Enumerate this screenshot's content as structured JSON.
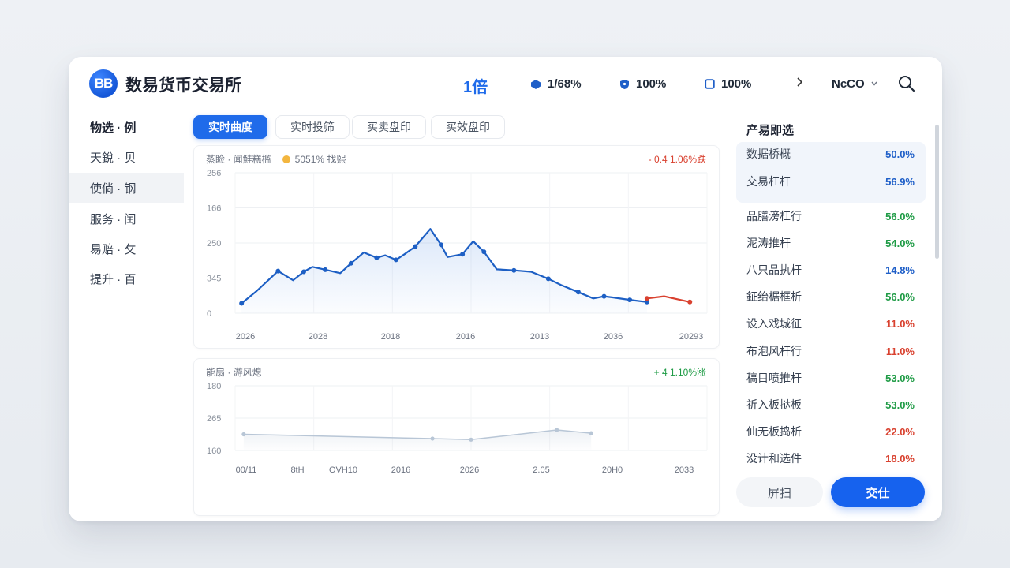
{
  "app": {
    "logo_text": "BB",
    "title": "数易货币交易所"
  },
  "header": {
    "leverage": "1倍",
    "stats": [
      {
        "icon": "hexagon-icon",
        "value": "1/68%"
      },
      {
        "icon": "shield-icon",
        "value": "100%"
      },
      {
        "icon": "square-icon",
        "value": "100%"
      }
    ],
    "account": "NcCO",
    "colors": {
      "accent": "#1f6bea"
    }
  },
  "sidebar": {
    "items": [
      {
        "label": "物选 · 例",
        "heading": true
      },
      {
        "label": "天銳 · 贝"
      },
      {
        "label": "使倘 · 钢",
        "active": true
      },
      {
        "label": "服务 · 闰"
      },
      {
        "label": "易赔 · 攵"
      },
      {
        "label": "提升 · 百"
      }
    ]
  },
  "tabs": [
    {
      "label": "实时曲度",
      "active": true
    },
    {
      "label": "实时投筛"
    },
    {
      "label": "买卖盘印"
    },
    {
      "label": "买效盘印"
    }
  ],
  "charts": {
    "main": {
      "title": "蒸睑 · 闻鮭糕槛",
      "legend": "5051%  找熙",
      "change": "- 0.4  1.06%跌"
    },
    "secondary": {
      "title": "能扇 · 游风熄",
      "change": "+ 4  1.10%涨"
    }
  },
  "chart_data": [
    {
      "type": "line",
      "title": "蒸睑 · 闻鮭糕槛",
      "y_tick_labels": [
        "0",
        "345",
        "250",
        "166",
        "256"
      ],
      "x_tick_labels": [
        "2026",
        "2028",
        "2018",
        "2016",
        "2013",
        "2036",
        "20293"
      ],
      "ylim": [
        0,
        4
      ],
      "grid": true,
      "series": [
        {
          "color": "#1d5fc4",
          "x": [
            0.15,
            0.5,
            1.0,
            1.35,
            1.6,
            1.8,
            2.1,
            2.45,
            2.7,
            3.0,
            3.3,
            3.5,
            3.75,
            3.95,
            4.2,
            4.55,
            4.8,
            4.95,
            5.3,
            5.55,
            5.8,
            6.1,
            6.5,
            6.9,
            7.3,
            7.6,
            8.0,
            8.35,
            8.6,
            8.8,
            9.2,
            9.6
          ],
          "y": [
            0.28,
            0.63,
            1.2,
            0.94,
            1.18,
            1.32,
            1.24,
            1.14,
            1.42,
            1.73,
            1.58,
            1.65,
            1.52,
            1.68,
            1.9,
            2.4,
            1.95,
            1.6,
            1.68,
            2.05,
            1.75,
            1.25,
            1.22,
            1.18,
            0.98,
            0.8,
            0.6,
            0.42,
            0.48,
            0.45,
            0.38,
            0.32
          ]
        },
        {
          "color": "#d9412f",
          "x": [
            9.6,
            10.0,
            10.6
          ],
          "y": [
            0.42,
            0.48,
            0.32
          ]
        }
      ]
    },
    {
      "type": "line",
      "title": "能扇 · 游风熄",
      "y_tick_labels": [
        "160",
        "265",
        "180"
      ],
      "x_tick_labels": [
        "00/11",
        "8tH",
        "OVH10",
        "2016",
        "2026",
        "2.05",
        "20H0",
        "2033"
      ],
      "ylim": [
        0,
        3
      ],
      "grid": true,
      "series": [
        {
          "color": "#b8c6d6",
          "x": [
            0.2,
            4.6,
            5.5,
            7.5,
            8.3
          ],
          "y": [
            0.75,
            0.55,
            0.5,
            0.95,
            0.8
          ]
        }
      ]
    }
  ],
  "right_panel": {
    "title": "产易即选",
    "items": [
      {
        "name": "数据桥概",
        "value": "50.0%",
        "color": "#1f5fc8",
        "highlight": true
      },
      {
        "name": "交易杠杆",
        "value": "56.9%",
        "color": "#1f5fc8",
        "highlight": true
      },
      {
        "name": "品膳滂杠行",
        "value": "56.0%",
        "color": "#1e9b45"
      },
      {
        "name": "泥涛推杆",
        "value": "54.0%",
        "color": "#1e9b45"
      },
      {
        "name": "八只品执杆",
        "value": "14.8%",
        "color": "#1f5fc8"
      },
      {
        "name": "鉦绐椐框析",
        "value": "56.0%",
        "color": "#1e9b45"
      },
      {
        "name": "设入戏城征",
        "value": "11.0%",
        "color": "#d9412f"
      },
      {
        "name": "布泡风杆行",
        "value": "11.0%",
        "color": "#d9412f"
      },
      {
        "name": "稿目喷推杆",
        "value": "53.0%",
        "color": "#1e9b45"
      },
      {
        "name": "祈入板挞板",
        "value": "53.0%",
        "color": "#1e9b45"
      },
      {
        "name": "仙无板捣析",
        "value": "22.0%",
        "color": "#d9412f"
      },
      {
        "name": "没计和选件",
        "value": "18.0%",
        "color": "#d9412f"
      }
    ]
  },
  "buttons": {
    "secondary": "屏扫",
    "primary": "交仕"
  }
}
